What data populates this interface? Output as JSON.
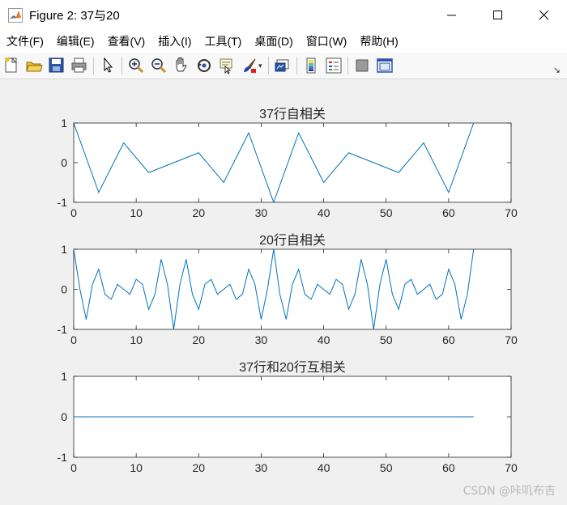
{
  "window": {
    "title": "Figure 2: 37与20",
    "controls": [
      "minimize-icon",
      "maximize-icon",
      "close-icon"
    ]
  },
  "menu": [
    "文件(F)",
    "编辑(E)",
    "查看(V)",
    "插入(I)",
    "工具(T)",
    "桌面(D)",
    "窗口(W)",
    "帮助(H)"
  ],
  "toolbar": [
    {
      "name": "new-figure-icon"
    },
    {
      "name": "open-file-icon"
    },
    {
      "name": "save-icon"
    },
    {
      "name": "print-icon"
    },
    {
      "sep": true
    },
    {
      "name": "pointer-icon"
    },
    {
      "sep": true
    },
    {
      "name": "zoom-in-icon"
    },
    {
      "name": "zoom-out-icon"
    },
    {
      "name": "pan-icon"
    },
    {
      "name": "rotate-3d-icon"
    },
    {
      "name": "data-cursor-icon"
    },
    {
      "name": "brush-icon",
      "caret": true
    },
    {
      "sep": true
    },
    {
      "name": "link-plot-icon"
    },
    {
      "sep": true
    },
    {
      "name": "colorbar-icon"
    },
    {
      "name": "legend-icon"
    },
    {
      "sep": true
    },
    {
      "name": "hide-plot-tools-icon"
    },
    {
      "name": "show-plot-tools-icon"
    }
  ],
  "colors": {
    "line": "#0072bd",
    "axes_bg": "#ffffff",
    "axes_border": "#262626",
    "figure_bg": "#f0f0f0"
  },
  "chart_data": [
    {
      "type": "line",
      "title": "37行自相关",
      "xlim": [
        0,
        70
      ],
      "ylim": [
        -1,
        1
      ],
      "xticks": [
        0,
        10,
        20,
        30,
        40,
        50,
        60,
        70
      ],
      "yticks": [
        -1,
        0,
        1
      ],
      "x": [
        0,
        4,
        8,
        12,
        16,
        20,
        24,
        28,
        32,
        36,
        40,
        44,
        48,
        52,
        56,
        60,
        64
      ],
      "y": [
        1,
        -0.75,
        0.5,
        -0.25,
        0,
        0.25,
        -0.5,
        0.75,
        -1,
        0.75,
        -0.5,
        0.25,
        0,
        -0.25,
        0.5,
        -0.75,
        1
      ]
    },
    {
      "type": "line",
      "title": "20行自相关",
      "xlim": [
        0,
        70
      ],
      "ylim": [
        -1,
        1
      ],
      "xticks": [
        0,
        10,
        20,
        30,
        40,
        50,
        60,
        70
      ],
      "yticks": [
        -1,
        0,
        1
      ],
      "x": [
        0,
        1,
        2,
        3,
        4,
        5,
        6,
        7,
        8,
        9,
        10,
        11,
        12,
        13,
        14,
        15,
        16,
        17,
        18,
        19,
        20,
        21,
        22,
        23,
        24,
        25,
        26,
        27,
        28,
        29,
        30,
        31,
        32,
        33,
        34,
        35,
        36,
        37,
        38,
        39,
        40,
        41,
        42,
        43,
        44,
        45,
        46,
        47,
        48,
        49,
        50,
        51,
        52,
        53,
        54,
        55,
        56,
        57,
        58,
        59,
        60,
        61,
        62,
        63,
        64
      ],
      "y": [
        1,
        0,
        -0.75,
        0.125,
        0.5,
        -0.125,
        -0.25,
        0.125,
        0,
        -0.125,
        0.25,
        0.125,
        -0.5,
        -0.125,
        0.75,
        0.125,
        -1,
        0.125,
        0.75,
        -0.125,
        -0.5,
        0.125,
        0.25,
        -0.125,
        0,
        0.125,
        -0.25,
        -0.125,
        0.5,
        0.125,
        -0.75,
        0,
        1,
        -0.125,
        -0.75,
        0.125,
        0.5,
        -0.125,
        -0.25,
        0.125,
        0,
        -0.125,
        0.25,
        0.125,
        -0.5,
        -0.125,
        0.75,
        0.125,
        -1,
        0.125,
        0.75,
        -0.125,
        -0.5,
        0.125,
        0.25,
        -0.125,
        0,
        0.125,
        -0.25,
        -0.125,
        0.5,
        0.125,
        -0.75,
        -0.125,
        1
      ]
    },
    {
      "type": "line",
      "title": "37行和20行互相关",
      "xlim": [
        0,
        70
      ],
      "ylim": [
        -1,
        1
      ],
      "xticks": [
        0,
        10,
        20,
        30,
        40,
        50,
        60,
        70
      ],
      "yticks": [
        -1,
        0,
        1
      ],
      "x": [
        0,
        64
      ],
      "y": [
        0,
        0
      ]
    }
  ],
  "watermark": "CSDN @咔叽布吉"
}
